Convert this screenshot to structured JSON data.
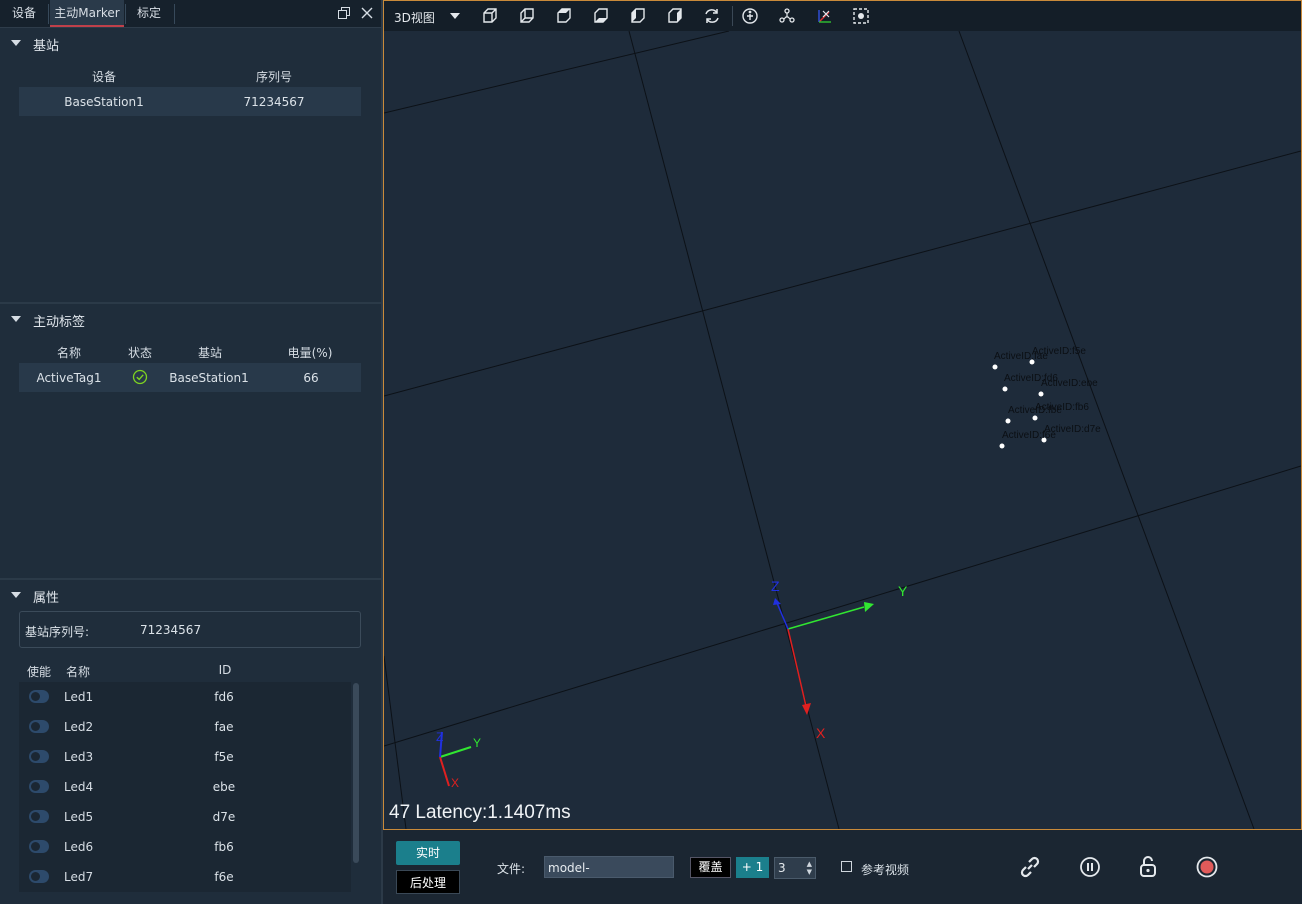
{
  "tabs": [
    "设备",
    "主动Marker",
    "标定"
  ],
  "active_tab": "主动Marker",
  "base_station_section": {
    "title": "基站",
    "columns": [
      "设备",
      "序列号"
    ],
    "rows": [
      {
        "device": "BaseStation1",
        "serial": "71234567"
      }
    ]
  },
  "active_tag_section": {
    "title": "主动标签",
    "columns": [
      "名称",
      "状态",
      "基站",
      "电量(%)"
    ],
    "rows": [
      {
        "name": "ActiveTag1",
        "status": "ok",
        "base": "BaseStation1",
        "battery": "66"
      }
    ]
  },
  "property_section": {
    "title": "属性",
    "base_serial_label": "基站序列号:",
    "base_serial_value": "71234567",
    "columns": [
      "使能",
      "名称",
      "ID"
    ],
    "leds": [
      {
        "name": "Led1",
        "id": "fd6"
      },
      {
        "name": "Led2",
        "id": "fae"
      },
      {
        "name": "Led3",
        "id": "f5e"
      },
      {
        "name": "Led4",
        "id": "ebe"
      },
      {
        "name": "Led5",
        "id": "d7e"
      },
      {
        "name": "Led6",
        "id": "fb6"
      },
      {
        "name": "Led7",
        "id": "f6e"
      }
    ]
  },
  "viewport": {
    "view_select": "3D视图",
    "latency_text": "47 Latency:1.1407ms",
    "axis_labels": {
      "x": "X",
      "y": "Y",
      "z": "Z"
    },
    "marker_labels": [
      "ActiveID:fae",
      "ActiveID:f5e",
      "ActiveID:fd6",
      "ActiveID:ebe",
      "ActiveID:fb6",
      "ActiveID:d7e",
      "ActiveID:fbe",
      "ActiveID:f6e"
    ]
  },
  "bottom": {
    "realtime_label": "实时",
    "postprocess_label": "后处理",
    "file_label": "文件:",
    "file_value": "model-",
    "cover_label": "覆盖",
    "plus_label": "+ 1",
    "spin_value": "3",
    "ref_video_label": "参考视频"
  },
  "colors": {
    "accent_teal": "#1b7f8c",
    "viewport_border": "#c98a3a",
    "status_ok": "#7ed321",
    "record": "#e05a5a"
  }
}
